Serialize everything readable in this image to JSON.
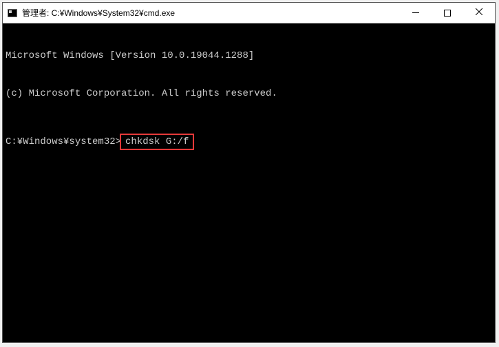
{
  "titlebar": {
    "title": "管理者: C:¥Windows¥System32¥cmd.exe"
  },
  "terminal": {
    "line1": "Microsoft Windows [Version 10.0.19044.1288]",
    "line2": "(c) Microsoft Corporation. All rights reserved.",
    "prompt": "C:¥Windows¥system32>",
    "command": "chkdsk G:/f"
  }
}
